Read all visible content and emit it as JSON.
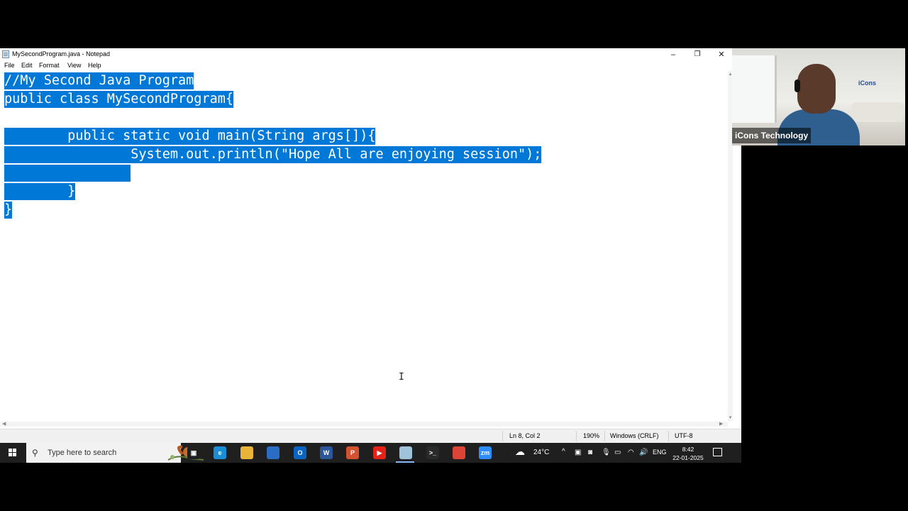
{
  "window": {
    "title": "MySecondProgram.java - Notepad",
    "minimize_glyph": "–",
    "restore_glyph": "❐",
    "close_glyph": "✕"
  },
  "menu": {
    "file": "File",
    "edit": "Edit",
    "format": "Format",
    "view": "View",
    "help": "Help"
  },
  "editor": {
    "lines": [
      "//My Second Java Program",
      "public class MySecondProgram{",
      "",
      "        public static void main(String args[]){",
      "                System.out.println(\"Hope All are enjoying session\");",
      "                ",
      "        }",
      "}"
    ],
    "selection_color": "#0078d7"
  },
  "statusbar": {
    "position": "Ln 8, Col 2",
    "zoom": "190%",
    "line_ending": "Windows (CRLF)",
    "encoding": "UTF-8"
  },
  "taskbar": {
    "search_placeholder": "Type here to search",
    "weather": "24°C",
    "language": "ENG",
    "time": "8:42",
    "date": "22-01-2025",
    "apps": [
      {
        "name": "task-view-icon",
        "glyph": "▣",
        "color": "#1f1f1f"
      },
      {
        "name": "edge-icon",
        "glyph": "e",
        "color": "#1a8fd8"
      },
      {
        "name": "file-explorer-icon",
        "glyph": "",
        "color": "#e8b53a"
      },
      {
        "name": "store-icon",
        "glyph": "",
        "color": "#2b6cc4"
      },
      {
        "name": "outlook-icon",
        "glyph": "O",
        "color": "#0a64c2"
      },
      {
        "name": "word-icon",
        "glyph": "W",
        "color": "#2b579a"
      },
      {
        "name": "powerpoint-icon",
        "glyph": "P",
        "color": "#d35230"
      },
      {
        "name": "youtube-icon",
        "glyph": "▶",
        "color": "#e62117"
      },
      {
        "name": "notepad-icon",
        "glyph": "",
        "color": "#9fc3d9"
      },
      {
        "name": "terminal-icon",
        "glyph": ">_",
        "color": "#2a2a2a"
      },
      {
        "name": "chrome-icon",
        "glyph": "",
        "color": "#db4437"
      },
      {
        "name": "zoom-icon",
        "glyph": "zm",
        "color": "#2d8cff"
      }
    ]
  },
  "webcam": {
    "participant_name": "iCons Technology",
    "logo_text": "iCons"
  }
}
